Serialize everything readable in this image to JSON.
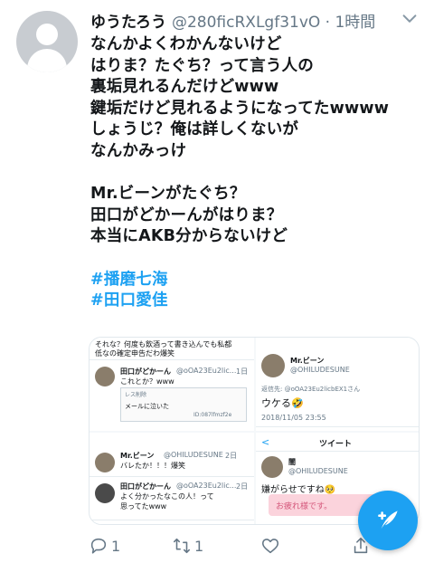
{
  "tweet": {
    "display_name": "ゆうたろう",
    "handle_time": "@280ficRXLgf31vO · 1時間",
    "lines": [
      "なんかよくわかんないけど",
      "はりま？たぐち？って言う人の",
      "裏垢見れるんだけどwww",
      "鍵垢だけど見れるようになってたwwww",
      "しょうじ？俺は詳しくないが",
      "なんかみっけ",
      "",
      "Mr.ビーンがたぐち？",
      "田口がどかーんがはりま？",
      "本当にAKB分からないけど",
      ""
    ],
    "hashtags": [
      "#播磨七海",
      "#田口愛佳"
    ]
  },
  "media": {
    "p1": {
      "top_text": "それな？何度も飲酒って書き込んでも私都",
      "top_text2": "低なの確定申告だわ爆笑",
      "name": "田口がどかーん",
      "handle": "@oOA23Eu2lic...",
      "time": "1日",
      "body": "これとか？www",
      "inner_label": "レス削除",
      "inner_id": "ID:087lfmzf2e",
      "inner_msg": "メールに泣いた"
    },
    "p2": {
      "name": "Mr.ビーン",
      "handle": "@OHILUDESUNE",
      "reply_to": "返信先: @oOA23Eu2licbEX1さん",
      "body": "ウケる🤣",
      "timestamp": "2018/11/05 23:55"
    },
    "p3": {
      "name1": "Mr.ビーン",
      "handle1": "@OHILUDESUNE",
      "time1": "2日",
      "body1": "バレたか！！！爆笑",
      "name2": "田口がどかーん",
      "handle2": "@oOA23Eu2lic...",
      "time2": "2日",
      "body2a": "よく分かったなこの人！って",
      "body2b": "思ってたwww"
    },
    "p4": {
      "back": "<",
      "header": "ツイート",
      "name": "闇",
      "handle": "@OHILUDESUNE",
      "body": "嫌がらせですね🥺",
      "pill": "お疲れ様です。"
    }
  },
  "actions": {
    "reply_count": "1",
    "retweet_count": "1"
  },
  "colors": {
    "accent": "#1da1f2",
    "muted": "#657786"
  }
}
